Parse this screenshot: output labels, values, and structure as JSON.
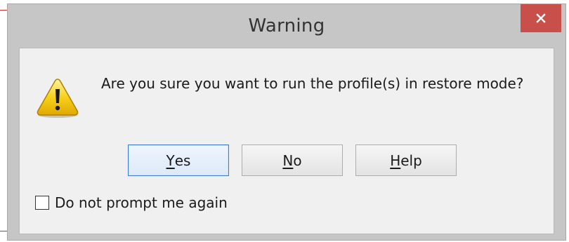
{
  "window": {
    "title": "Warning",
    "close_icon": "close-icon",
    "close_color": "#c9504a"
  },
  "message": {
    "icon": "warning-icon",
    "text": "Are you sure you want to run the profile(s) in restore mode?"
  },
  "buttons": {
    "yes": {
      "accel": "Y",
      "rest": "es",
      "is_default": true
    },
    "no": {
      "accel": "N",
      "rest": "o"
    },
    "help": {
      "accel": "H",
      "rest": "elp"
    }
  },
  "option": {
    "label": "Do not prompt me again",
    "checked": false
  }
}
